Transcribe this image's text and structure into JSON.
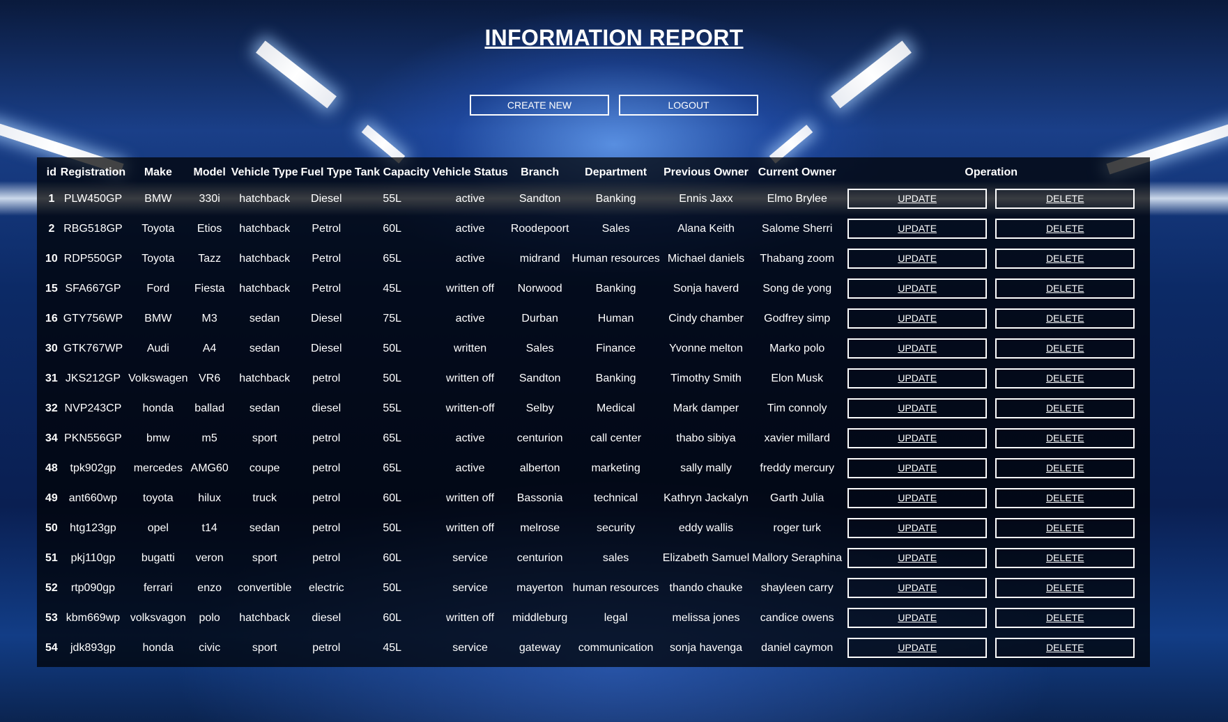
{
  "header": {
    "title": "INFORMATION REPORT",
    "create_new_label": "CREATE NEW",
    "logout_label": "LOGOUT"
  },
  "table": {
    "columns": [
      "id",
      "Registration",
      "Make",
      "Model",
      "Vehicle Type",
      "Fuel Type",
      "Tank Capacity",
      "Vehicle Status",
      "Branch",
      "Department",
      "Previous Owner",
      "Current Owner",
      "Operation"
    ],
    "update_label": "UPDATE",
    "delete_label": "DELETE",
    "rows": [
      [
        "1",
        "PLW450GP",
        "BMW",
        "330i",
        "hatchback",
        "Diesel",
        "55L",
        "active",
        "Sandton",
        "Banking",
        "Ennis Jaxx",
        "Elmo Brylee"
      ],
      [
        "2",
        "RBG518GP",
        "Toyota",
        "Etios",
        "hatchback",
        "Petrol",
        "60L",
        "active",
        "Roodepoort",
        "Sales",
        "Alana Keith",
        "Salome Sherri"
      ],
      [
        "10",
        "RDP550GP",
        "Toyota",
        "Tazz",
        "hatchback",
        "Petrol",
        "65L",
        "active",
        "midrand",
        "Human resources",
        "Michael daniels",
        "Thabang zoom"
      ],
      [
        "15",
        "SFA667GP",
        "Ford",
        "Fiesta",
        "hatchback",
        "Petrol",
        "45L",
        "written off",
        "Norwood",
        "Banking",
        "Sonja haverd",
        "Song de yong"
      ],
      [
        "16",
        "GTY756WP",
        "BMW",
        "M3",
        "sedan",
        "Diesel",
        "75L",
        "active",
        "Durban",
        "Human",
        "Cindy chamber",
        "Godfrey simp"
      ],
      [
        "30",
        "GTK767WP",
        "Audi",
        "A4",
        "sedan",
        "Diesel",
        "50L",
        "written",
        "Sales",
        "Finance",
        "Yvonne melton",
        "Marko polo"
      ],
      [
        "31",
        "JKS212GP",
        "Volkswagen",
        "VR6",
        "hatchback",
        "petrol",
        "50L",
        "written off",
        "Sandton",
        "Banking",
        "Timothy Smith",
        "Elon Musk"
      ],
      [
        "32",
        "NVP243CP",
        "honda",
        "ballad",
        "sedan",
        "diesel",
        "55L",
        "written-off",
        "Selby",
        "Medical",
        "Mark damper",
        "Tim connoly"
      ],
      [
        "34",
        "PKN556GP",
        "bmw",
        "m5",
        "sport",
        "petrol",
        "65L",
        "active",
        "centurion",
        "call center",
        "thabo sibiya",
        "xavier millard"
      ],
      [
        "48",
        "tpk902gp",
        "mercedes",
        "AMG60",
        "coupe",
        "petrol",
        "65L",
        "active",
        "alberton",
        "marketing",
        "sally mally",
        "freddy mercury"
      ],
      [
        "49",
        "ant660wp",
        "toyota",
        "hilux",
        "truck",
        "petrol",
        "60L",
        "written off",
        "Bassonia",
        "technical",
        "Kathryn Jackalyn",
        "Garth Julia"
      ],
      [
        "50",
        "htg123gp",
        "opel",
        "t14",
        "sedan",
        "petrol",
        "50L",
        "written off",
        "melrose",
        "security",
        "eddy wallis",
        "roger turk"
      ],
      [
        "51",
        "pkj110gp",
        "bugatti",
        "veron",
        "sport",
        "petrol",
        "60L",
        "service",
        "centurion",
        "sales",
        "Elizabeth Samuel",
        "Mallory Seraphina"
      ],
      [
        "52",
        "rtp090gp",
        "ferrari",
        "enzo",
        "convertible",
        "electric",
        "50L",
        "service",
        "mayerton",
        "human resources",
        "thando chauke",
        "shayleen carry"
      ],
      [
        "53",
        "kbm669wp",
        "volksvagon",
        "polo",
        "hatchback",
        "diesel",
        "60L",
        "written off",
        "middleburg",
        "legal",
        "melissa jones",
        "candice owens"
      ],
      [
        "54",
        "jdk893gp",
        "honda",
        "civic",
        "sport",
        "petrol",
        "45L",
        "service",
        "gateway",
        "communication",
        "sonja havenga",
        "daniel caymon"
      ]
    ]
  }
}
